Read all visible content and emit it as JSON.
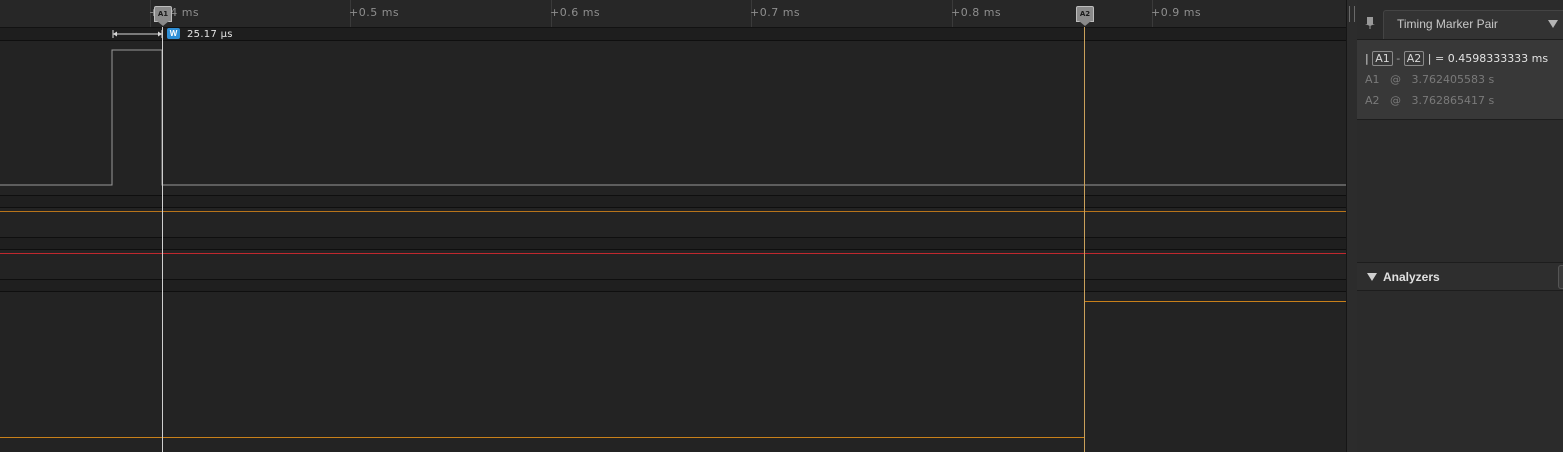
{
  "timeline": {
    "ticks": [
      "+0.4 ms",
      "+0.5 ms",
      "+0.6 ms",
      "+0.7 ms",
      "+0.8 ms",
      "+0.9 ms"
    ],
    "width_measurement": {
      "badge": "W",
      "value": "25.17 μs"
    }
  },
  "markers": [
    {
      "label": "A1",
      "color": "#cfcfcf"
    },
    {
      "label": "A2",
      "color": "#c9a05a"
    }
  ],
  "channels": {
    "colors": {
      "ch0": "#9a9a9a",
      "ch1": "#b8741a",
      "ch2": "#c0282e",
      "ch3": "#c8801a"
    }
  },
  "side_panel": {
    "timing": {
      "title": "Timing Marker Pair",
      "pin_icon": "pin-icon",
      "dropdown_icon": "triangle-down-icon",
      "diff": {
        "bar_left": "|",
        "a": "A1",
        "minus": "-",
        "b": "A2",
        "bar_right": "|",
        "equals": "=",
        "value": "0.4598333333 ms"
      },
      "rows": [
        {
          "name": "A1",
          "at": "@",
          "value": "3.762405583 s"
        },
        {
          "name": "A2",
          "at": "@",
          "value": "3.762865417 s"
        }
      ]
    },
    "analyzers": {
      "title": "Analyzers",
      "collapse_icon": "triangle-down-icon"
    }
  }
}
